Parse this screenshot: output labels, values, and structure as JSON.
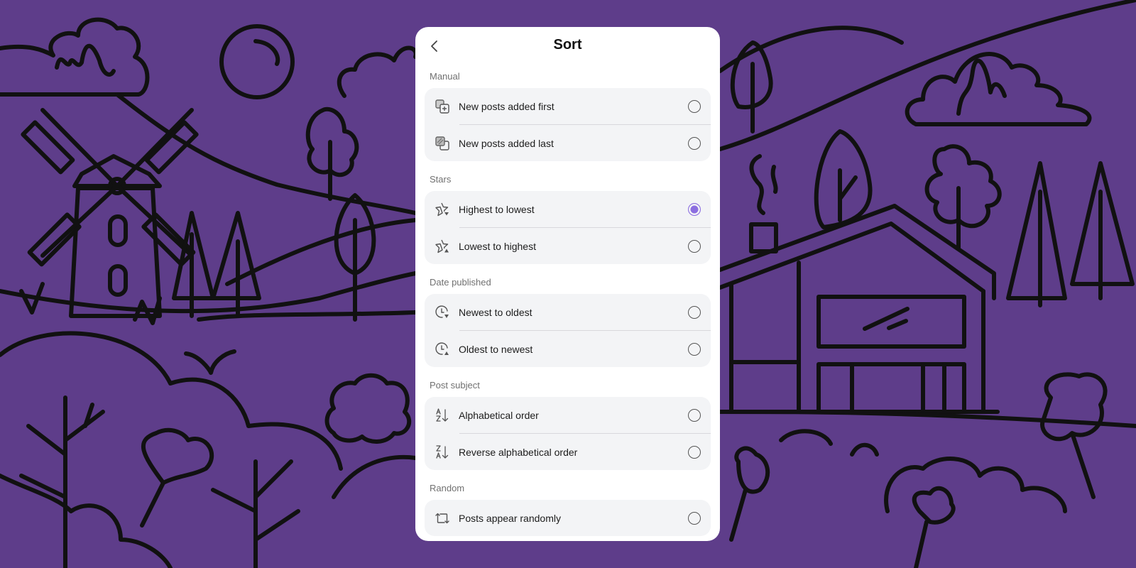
{
  "background": {
    "color": "#5e3d8a",
    "illustration": "countryside line-art scene: windmill, sun, clouds, trees, house, flowers"
  },
  "accent_color": "#8c6ee0",
  "sheet": {
    "title": "Sort",
    "back_icon": "chevron-left-icon",
    "sections": [
      {
        "label": "Manual",
        "options": [
          {
            "label": "New posts added first",
            "icon": "stack-add-first-icon",
            "selected": false
          },
          {
            "label": "New posts added last",
            "icon": "stack-add-last-icon",
            "selected": false
          }
        ]
      },
      {
        "label": "Stars",
        "options": [
          {
            "label": "Highest to lowest",
            "icon": "star-descending-icon",
            "selected": true
          },
          {
            "label": "Lowest to highest",
            "icon": "star-ascending-icon",
            "selected": false
          }
        ]
      },
      {
        "label": "Date published",
        "options": [
          {
            "label": "Newest to oldest",
            "icon": "clock-descending-icon",
            "selected": false
          },
          {
            "label": "Oldest to newest",
            "icon": "clock-ascending-icon",
            "selected": false
          }
        ]
      },
      {
        "label": "Post subject",
        "options": [
          {
            "label": "Alphabetical order",
            "icon": "sort-a-z-icon",
            "selected": false
          },
          {
            "label": "Reverse alphabetical order",
            "icon": "sort-z-a-icon",
            "selected": false
          }
        ]
      },
      {
        "label": "Random",
        "options": [
          {
            "label": "Posts appear randomly",
            "icon": "shuffle-loop-icon",
            "selected": false
          }
        ]
      }
    ]
  }
}
